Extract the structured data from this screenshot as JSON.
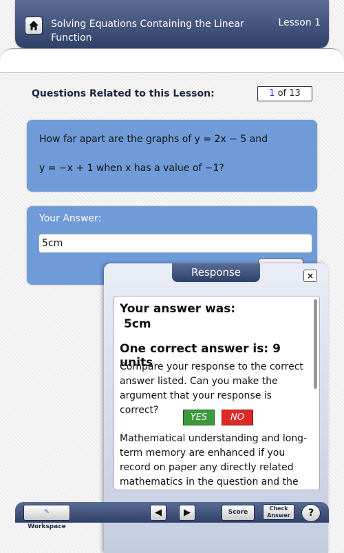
{
  "header": {
    "home_icon": "home-icon",
    "title": "Solving Equations Containing the Linear Function",
    "lesson": "Lesson 1"
  },
  "questions": {
    "heading": "Questions Related to this Lesson:",
    "current": "1",
    "of_total": "of 13"
  },
  "question": {
    "line1": "How far apart are the graphs of y = 2x − 5 and",
    "line2": "y = −x + 1 when x has a value of −1?"
  },
  "answer": {
    "label": "Your Answer:",
    "value": "5cm"
  },
  "response": {
    "title": "Response",
    "close": "×",
    "your_answer_label": "Your answer was:",
    "your_answer_value": "5cm",
    "correct_label": "One correct answer is:  9 units",
    "compare_text": "Compare your response to the correct answer listed. Can you make the argument that your response is correct?",
    "yes": "YES",
    "no": "NO",
    "note": "Mathematical understanding and long-term memory are enhanced if you record on paper any directly related mathematics in the question and the correct answer in a"
  },
  "toolbar": {
    "workspace": "Workspace",
    "prev": "◀",
    "next": "▶",
    "score": "Score",
    "check_line1": "Check",
    "check_line2": "Answer",
    "help": "?"
  },
  "colors": {
    "header": "#3b4c76",
    "panel": "#6f9bd8",
    "yes": "#3c9a3c",
    "no": "#e02828"
  }
}
